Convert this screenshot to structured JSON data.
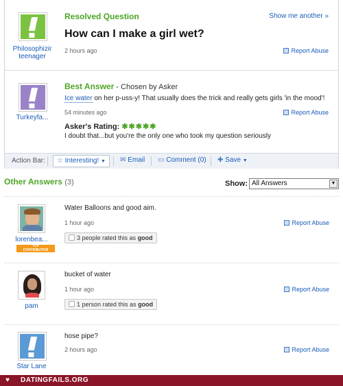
{
  "colors": {
    "green": "#4ea525",
    "link": "#1a5cb8",
    "purple_avatar": "#9a82c9",
    "blue_avatar": "#5b9bd5",
    "green_avatar": "#7cc242",
    "footer": "#8a1428"
  },
  "question": {
    "status": "Resolved Question",
    "show_another": "Show me another »",
    "title": "How can I make a girl wet?",
    "time": "2 hours ago",
    "report": "Report Abuse",
    "asker": {
      "name_line1": "Philosophizir",
      "name_line2": "teenager",
      "avatar_icon": "exclamation-icon"
    }
  },
  "best_answer": {
    "label": "Best Answer",
    "chosen": " - Chosen by Asker",
    "text_link": "Ice water",
    "text_rest": " on her p-uss-y! That usually does the trick and really gets girls 'in the mood'!",
    "time": "54 minutes ago",
    "report": "Report Abuse",
    "user": "Turkeyfa...",
    "rating_label": "Asker's Rating:",
    "stars": "✱✱✱✱✱",
    "rating_comment": "I doubt that...but you're the only one who took my question seriously"
  },
  "action_bar": {
    "label": "Action Bar:",
    "interesting": "Interesting!",
    "email": "Email",
    "comment": "Comment (0)",
    "save": "Save"
  },
  "other_answers": {
    "heading": "Other Answers",
    "count": "(3)",
    "show_label": "Show:",
    "show_selected": "All Answers",
    "items": [
      {
        "user": "lorenbea...",
        "badge_line1": "TOP",
        "badge_line2": "CONTRIBUTOR",
        "text": "Water Balloons and good aim.",
        "time": "1 hour ago",
        "report": "Report Abuse",
        "rated_pre": "3 people rated this as ",
        "rated_word": "good"
      },
      {
        "user": "pam",
        "text": "bucket of water",
        "time": "1 hour ago",
        "report": "Report Abuse",
        "rated_pre": "1 person rated this as ",
        "rated_word": "good"
      },
      {
        "user": "Star Lane",
        "text": "hose pipe?",
        "time": "2 hours ago",
        "report": "Report Abuse"
      }
    ]
  },
  "footer": {
    "brand": "DATINGFAILS.ORG"
  }
}
